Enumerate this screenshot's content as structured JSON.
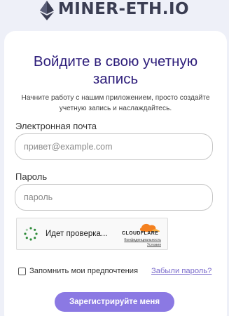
{
  "brand": {
    "name": "MINER-ETH.IO",
    "logo_icon": "ethereum-diamond-icon"
  },
  "login": {
    "title": "Войдите в свою учетную запись",
    "subtitle": "Начните работу с нашим приложением, просто создайте учетную запись и наслаждайтесь.",
    "email": {
      "label": "Электронная почта",
      "placeholder": "привет@example.com",
      "value": ""
    },
    "password": {
      "label": "Пароль",
      "placeholder": "пароль",
      "value": ""
    },
    "remember_label": "Запомнить мои предпочтения",
    "remember_checked": false,
    "forgot_label": "Забыли пароль?",
    "register_label": "Зарегистрируйте меня"
  },
  "captcha": {
    "status": "Идет проверка...",
    "brand": "CLOUDFLARE",
    "privacy_link": "Конфиденциальность",
    "terms_link": "Условия",
    "spinner_icon": "loading-spinner-icon",
    "brand_color": "#f48120"
  },
  "colors": {
    "background": "#eef0f8",
    "title": "#2d1d7a",
    "accent": "#8b79e3",
    "link": "#7a6acb"
  }
}
